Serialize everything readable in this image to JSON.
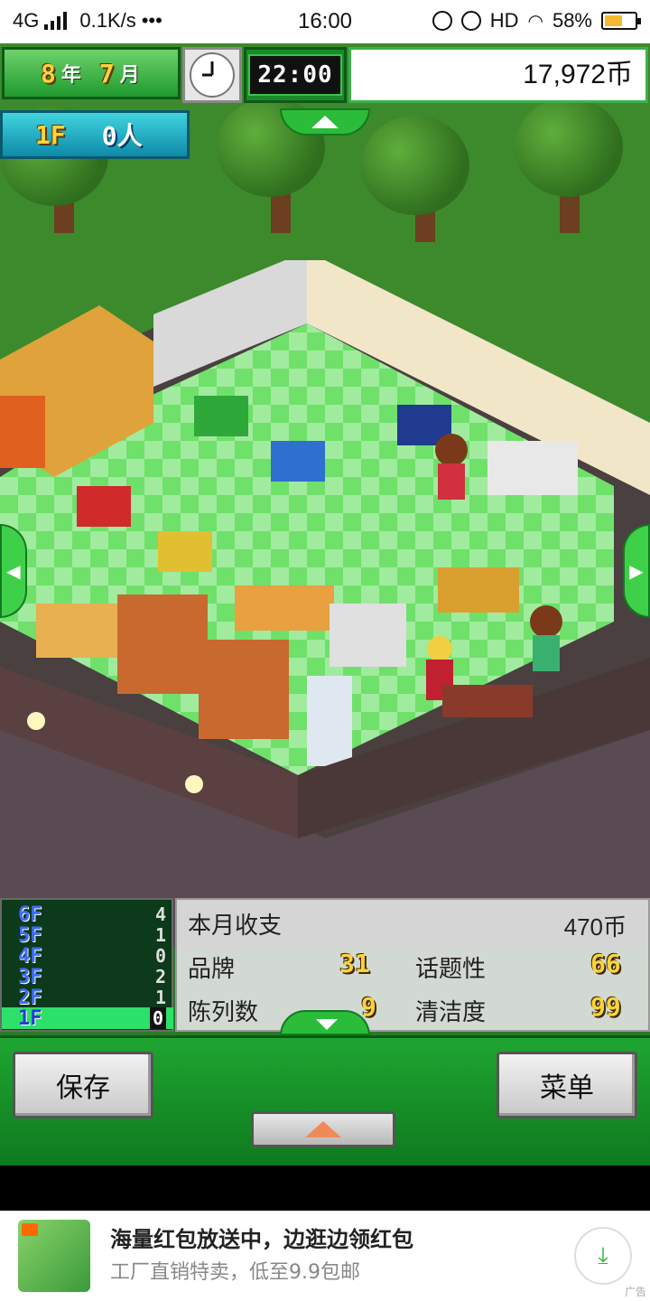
{
  "status_bar": {
    "network": "4G",
    "speed": "0.1K/s",
    "dots": "•••",
    "time": "16:00",
    "hd": "HD",
    "battery_pct": "58%",
    "battery_level": 0.58
  },
  "hud": {
    "year": "8",
    "year_unit": "年",
    "month": "7",
    "month_unit": "月",
    "clock_time": "22:00",
    "money": "17,972币",
    "floor": "1F",
    "visitors": "0人"
  },
  "floors": [
    {
      "label": "6F",
      "count": "4"
    },
    {
      "label": "5F",
      "count": "1"
    },
    {
      "label": "4F",
      "count": "0"
    },
    {
      "label": "3F",
      "count": "2"
    },
    {
      "label": "2F",
      "count": "1"
    },
    {
      "label": "1F",
      "count": "0"
    }
  ],
  "stats": {
    "monthly_label": "本月收支",
    "monthly_value": "470币",
    "brand_label": "品牌",
    "brand_value": "31",
    "topic_label": "话题性",
    "topic_value": "66",
    "display_label": "陈列数",
    "display_value": "9",
    "clean_label": "清洁度",
    "clean_value": "99"
  },
  "buttons": {
    "save": "保存",
    "menu": "菜单"
  },
  "ad": {
    "title": "海量红包放送中，边逛边领红包",
    "subtitle": "工厂直销特卖，低至9.9包邮",
    "tag": "广告"
  },
  "colors": {
    "accent_green": "#1fa531",
    "number_yellow": "#ffd23a",
    "floor_blue": "#3c6cff"
  }
}
